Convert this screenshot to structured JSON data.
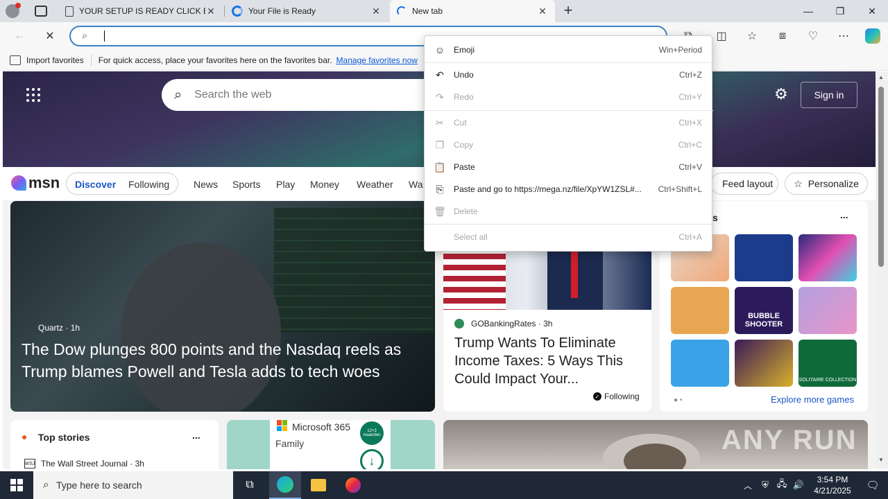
{
  "tabs": [
    {
      "title": "YOUR SETUP IS READY CLICK BEL",
      "active": false
    },
    {
      "title": "Your File is Ready",
      "active": false
    },
    {
      "title": "New tab",
      "active": true
    }
  ],
  "favorites_bar": {
    "import_label": "Import favorites",
    "hint": "For quick access, place your favorites here on the favorites bar.",
    "manage_link": "Manage favorites now"
  },
  "msn": {
    "search_placeholder": "Search the web",
    "signin": "Sign in",
    "logo": "msn",
    "nav": {
      "discover": "Discover",
      "following": "Following",
      "links": [
        "News",
        "Sports",
        "Play",
        "Money",
        "Weather",
        "Wa"
      ],
      "feed_layout": "Feed layout",
      "personalize": "Personalize"
    },
    "hero_story": {
      "source": "Quartz",
      "time": "1h",
      "headline": "The Dow plunges 800 points and the Nasdaq reels as Trump blames Powell and Tesla adds to tech woes"
    },
    "side_story": {
      "source": "GOBankingRates",
      "time": "3h",
      "headline": "Trump Wants To Eliminate Income Taxes: 5 Ways This Could Impact Your...",
      "following": "Following"
    },
    "games": {
      "title_fragment": "s",
      "more": "...",
      "explore": "Explore more games",
      "tiles": [
        "BUBBLE SHOOTER",
        "SOLITAIRE COLLECTION"
      ]
    },
    "top_stories": {
      "title": "Top stories",
      "more": "...",
      "first_source": "The Wall Street Journal",
      "first_time": "3h"
    },
    "ad": {
      "brand": "Microsoft 365",
      "product": "Family",
      "badge": "12+3 maanden"
    }
  },
  "context_menu": [
    {
      "label": "Emoji",
      "shortcut": "Win+Period",
      "icon": "emoji-icon",
      "disabled": false
    },
    {
      "label": "Undo",
      "shortcut": "Ctrl+Z",
      "icon": "undo-icon",
      "disabled": false
    },
    {
      "label": "Redo",
      "shortcut": "Ctrl+Y",
      "icon": "redo-icon",
      "disabled": true
    },
    {
      "label": "Cut",
      "shortcut": "Ctrl+X",
      "icon": "cut-icon",
      "disabled": true
    },
    {
      "label": "Copy",
      "shortcut": "Ctrl+C",
      "icon": "copy-icon",
      "disabled": true
    },
    {
      "label": "Paste",
      "shortcut": "Ctrl+V",
      "icon": "paste-icon",
      "disabled": false
    },
    {
      "label": "Paste and go to https://mega.nz/file/XpYW1ZSL#...",
      "shortcut": "Ctrl+Shift+L",
      "icon": "paste-go-icon",
      "disabled": false
    },
    {
      "label": "Delete",
      "shortcut": "",
      "icon": "delete-icon",
      "disabled": true
    },
    {
      "label": "Select all",
      "shortcut": "Ctrl+A",
      "icon": "",
      "disabled": true
    }
  ],
  "taskbar": {
    "search_placeholder": "Type here to search",
    "time": "3:54 PM",
    "date": "4/21/2025"
  },
  "watermark": "ANY RUN",
  "colors": {
    "accent": "#3b82c4",
    "link": "#0b57d0",
    "taskbar": "#1f2837"
  }
}
